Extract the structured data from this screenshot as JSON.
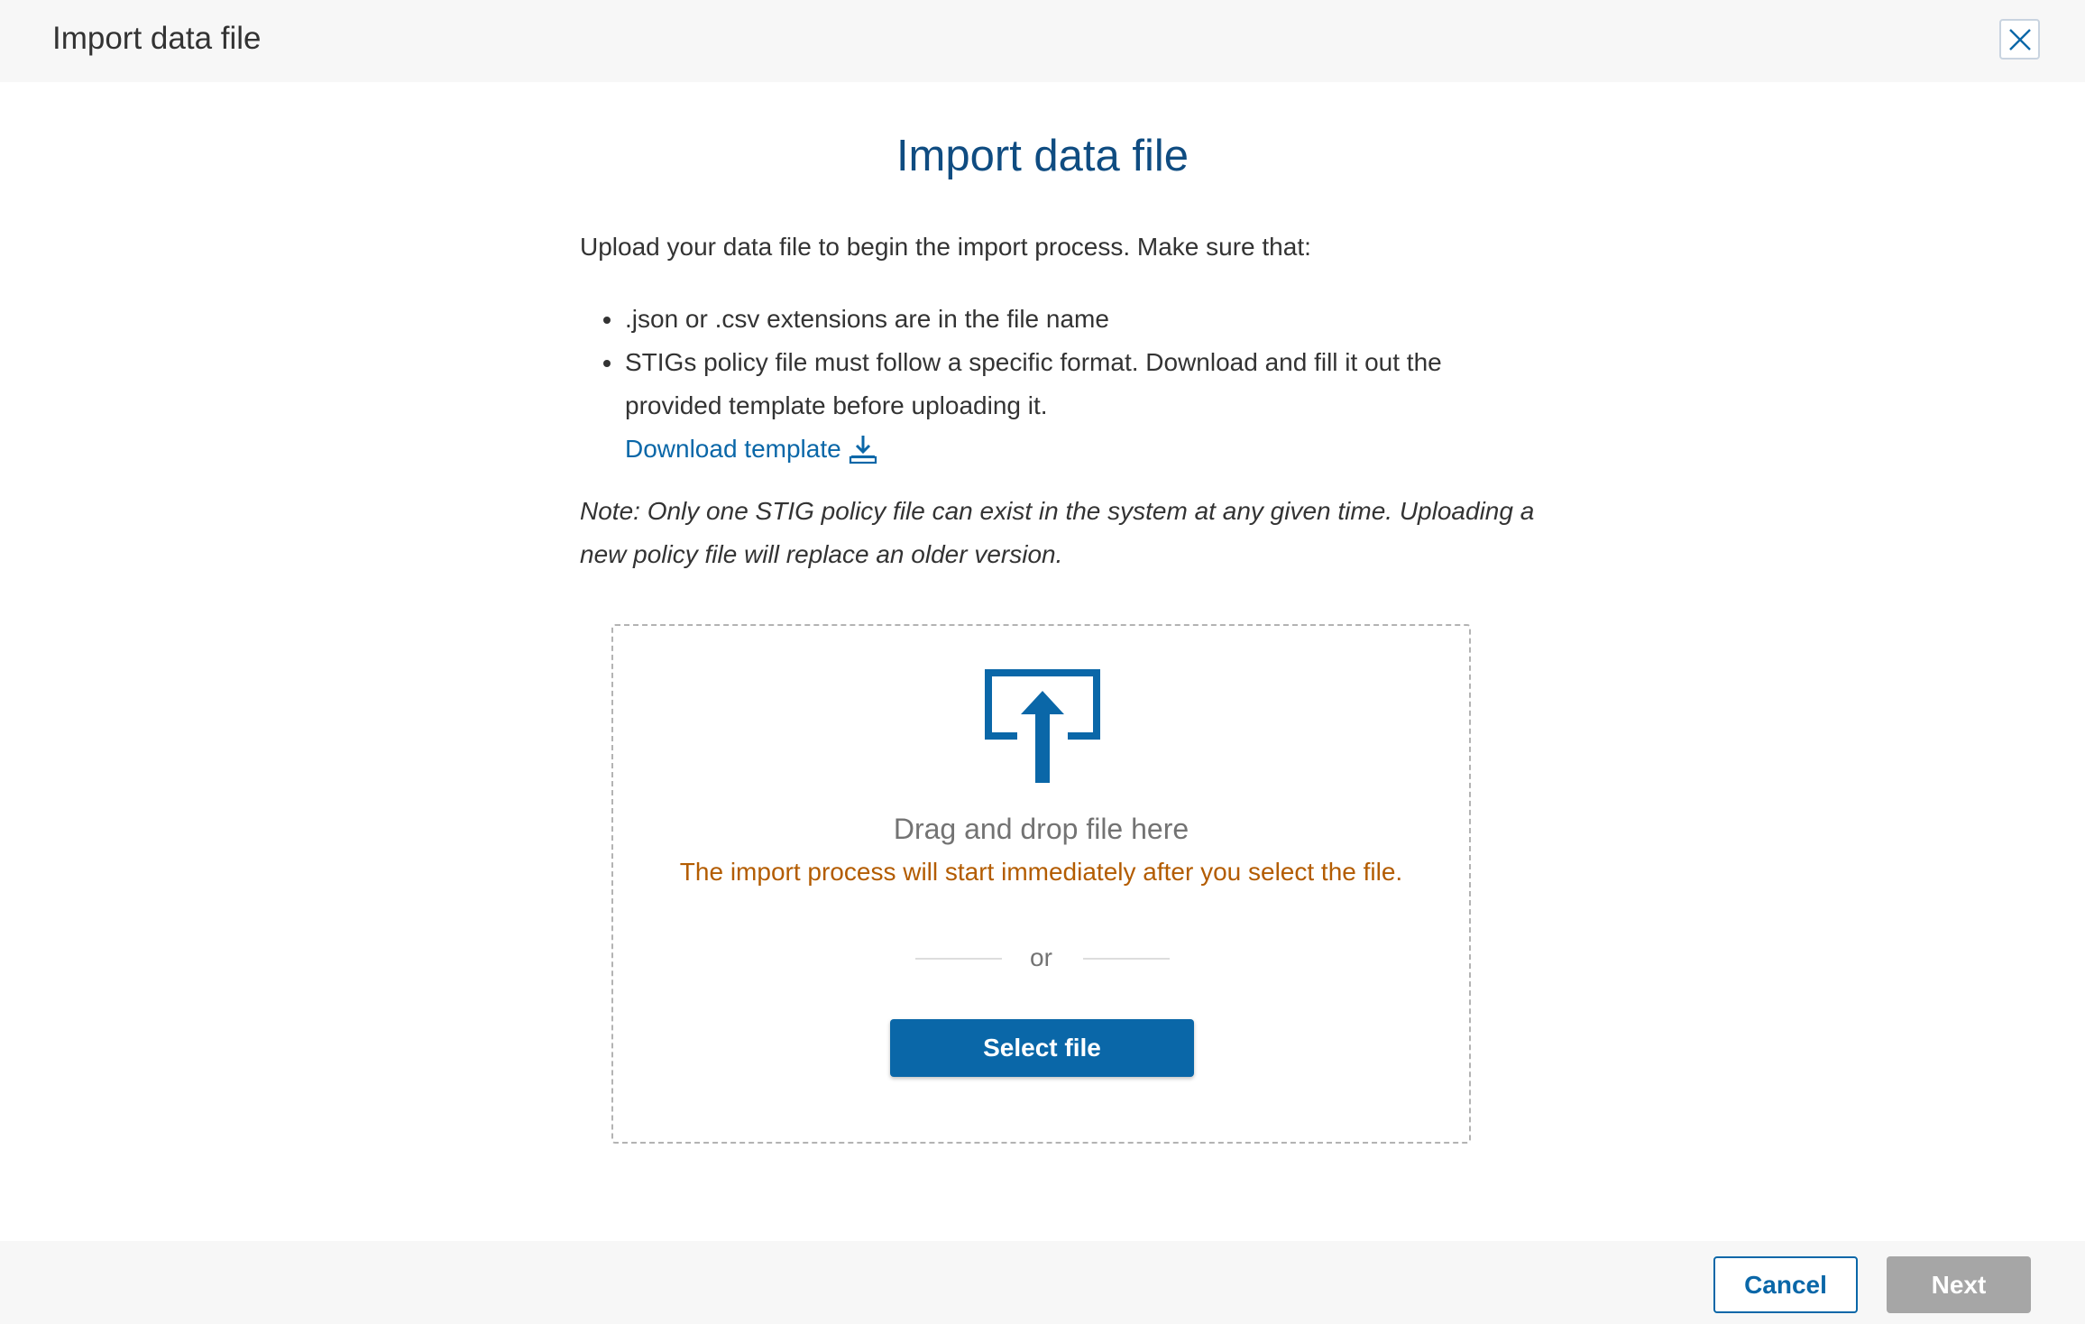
{
  "header": {
    "title": "Import data file",
    "close_icon": "close-icon"
  },
  "main": {
    "title": "Import data file",
    "intro": "Upload your data file to begin the import process. Make sure that:",
    "bullets": {
      "first": ".json or .csv extensions are in the file name",
      "second_line1": "STIGs policy file must follow a specific format. Download and fill it out the",
      "second_line2": "provided template before uploading it."
    },
    "download_link": {
      "label": "Download template",
      "icon": "download-icon"
    },
    "note": {
      "line1": "Note: Only one STIG policy file can exist in the system at any given time. Uploading a",
      "line2": "new policy file will replace an older version."
    }
  },
  "dropzone": {
    "icon": "upload-icon",
    "drag_text": "Drag and drop file here",
    "warning_text": "The import process will start immediately after you select the file.",
    "or_text": "or",
    "select_button": "Select file"
  },
  "footer": {
    "cancel_label": "Cancel",
    "next_label": "Next"
  },
  "colors": {
    "primary": "#0a67a8",
    "title": "#0f4c81",
    "warning": "#b35c00",
    "disabled": "#a6a6a6",
    "bar_background": "#f7f7f7"
  }
}
